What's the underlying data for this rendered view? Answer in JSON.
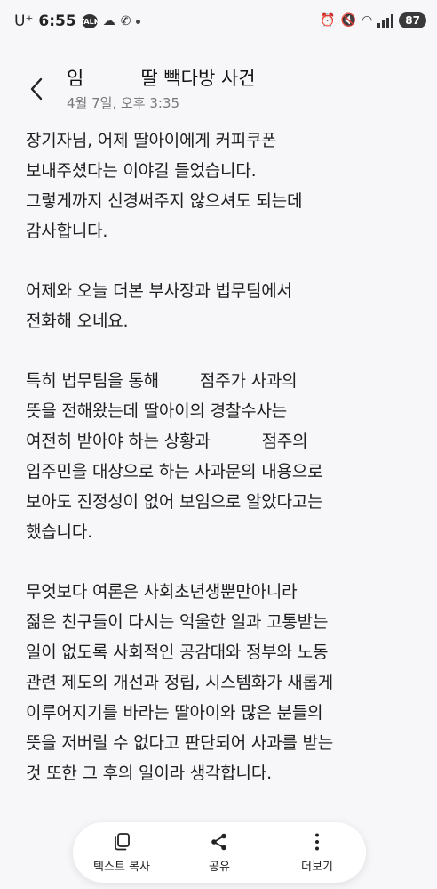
{
  "status_bar": {
    "carrier": "U⁺",
    "time": "6:55",
    "talk_badge": "TALK",
    "battery": "87",
    "icons": [
      "kakaotalk-icon",
      "cloud-icon",
      "phone-icon",
      "alarm-icon",
      "mute-icon",
      "wifi-icon",
      "signal-icon"
    ]
  },
  "header": {
    "title_start": "임",
    "title_end": "딸 빽다방 사건",
    "timestamp": "4월 7일, 오후 3:35"
  },
  "body": {
    "p1": [
      "장기자님, 어제 딸아이에게 커피쿠폰",
      "보내주셨다는 이야길 들었습니다.",
      "그렇게까지 신경써주지 않으셔도 되는데",
      "감사합니다."
    ],
    "p2": [
      "어제와 오늘 더본 부사장과 법무팀에서",
      "전화해 오네요."
    ],
    "p3_l1a": "특히 법무팀을 통해",
    "p3_l1b": "점주가 사과의",
    "p3_l2": "뜻을 전해왔는데 딸아이의 경찰수사는",
    "p3_l3a": "여전히 받아야 하는 상황과",
    "p3_l3b": "점주의",
    "p3_l4": "입주민을 대상으로 하는 사과문의 내용으로",
    "p3_l5": "보아도 진정성이 없어 보임으로 알았다고는",
    "p3_l6": "했습니다.",
    "p4": [
      "무엇보다 여론은 사회초년생뿐만아니라",
      "젊은 친구들이 다시는 억울한 일과 고통받는",
      "일이 없도록 사회적인 공감대와 정부와 노동",
      "관련 제도의 개선과 정립, 시스템화가 새롭게",
      "이루어지기를 바라는 딸아이와 많은 분들의",
      "뜻을 저버릴 수 없다고 판단되어 사과를 받는",
      "것 또한 그 후의 일이라 생각합니다."
    ]
  },
  "toolbar": {
    "copy_label": "텍스트 복사",
    "share_label": "공유",
    "more_label": "더보기"
  }
}
